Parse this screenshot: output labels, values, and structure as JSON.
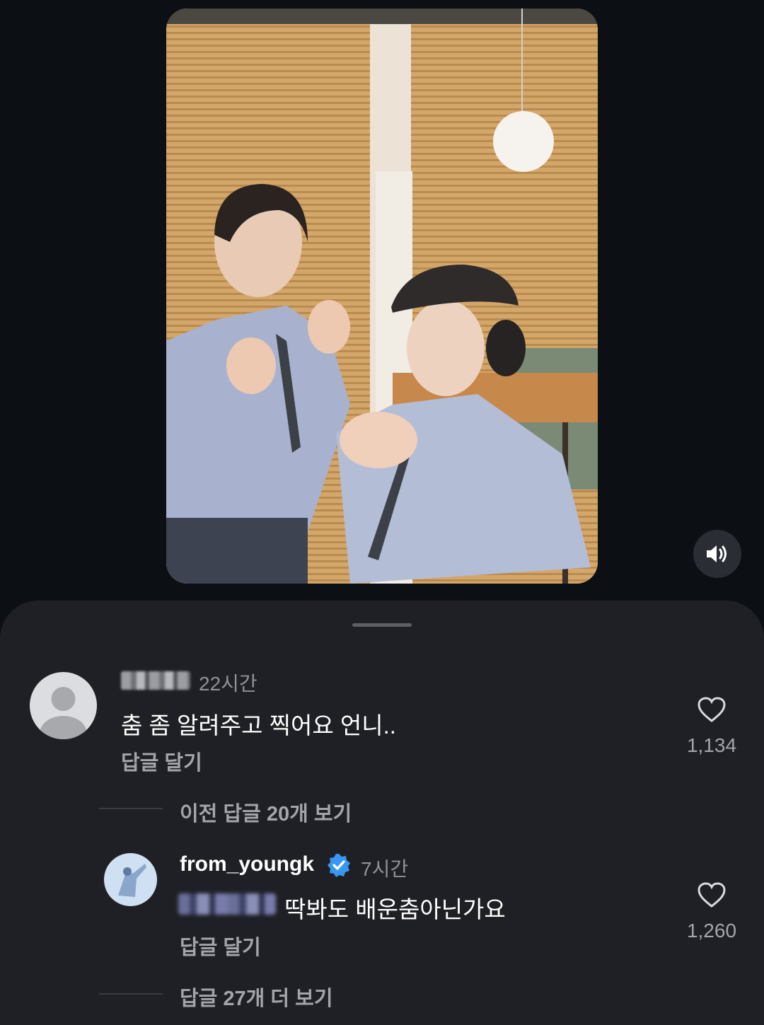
{
  "video": {
    "sound_icon": "speaker-sound-on-icon"
  },
  "comments": [
    {
      "time": "22시간",
      "text": "춤 좀 알려주고 찍어요 언니..",
      "reply_label": "답글 달기",
      "likes": "1,134",
      "like_icon": "heart-outline-icon",
      "avatar": "default-avatar-icon"
    }
  ],
  "thread": {
    "previous_replies_label": "이전 답글 20개 보기",
    "reply": {
      "username": "from_youngk",
      "verified_icon": "verified-badge-icon",
      "time": "7시간",
      "text": "딱봐도 배운춤아닌가요",
      "reply_label": "답글 달기",
      "likes": "1,260",
      "like_icon": "heart-outline-icon"
    },
    "more_replies_label": "답글 27개 더 보기"
  },
  "colors": {
    "background": "#0c0f14",
    "sheet": "#1f2025",
    "verified": "#3897f0",
    "secondary_text": "#a3a5ab"
  }
}
